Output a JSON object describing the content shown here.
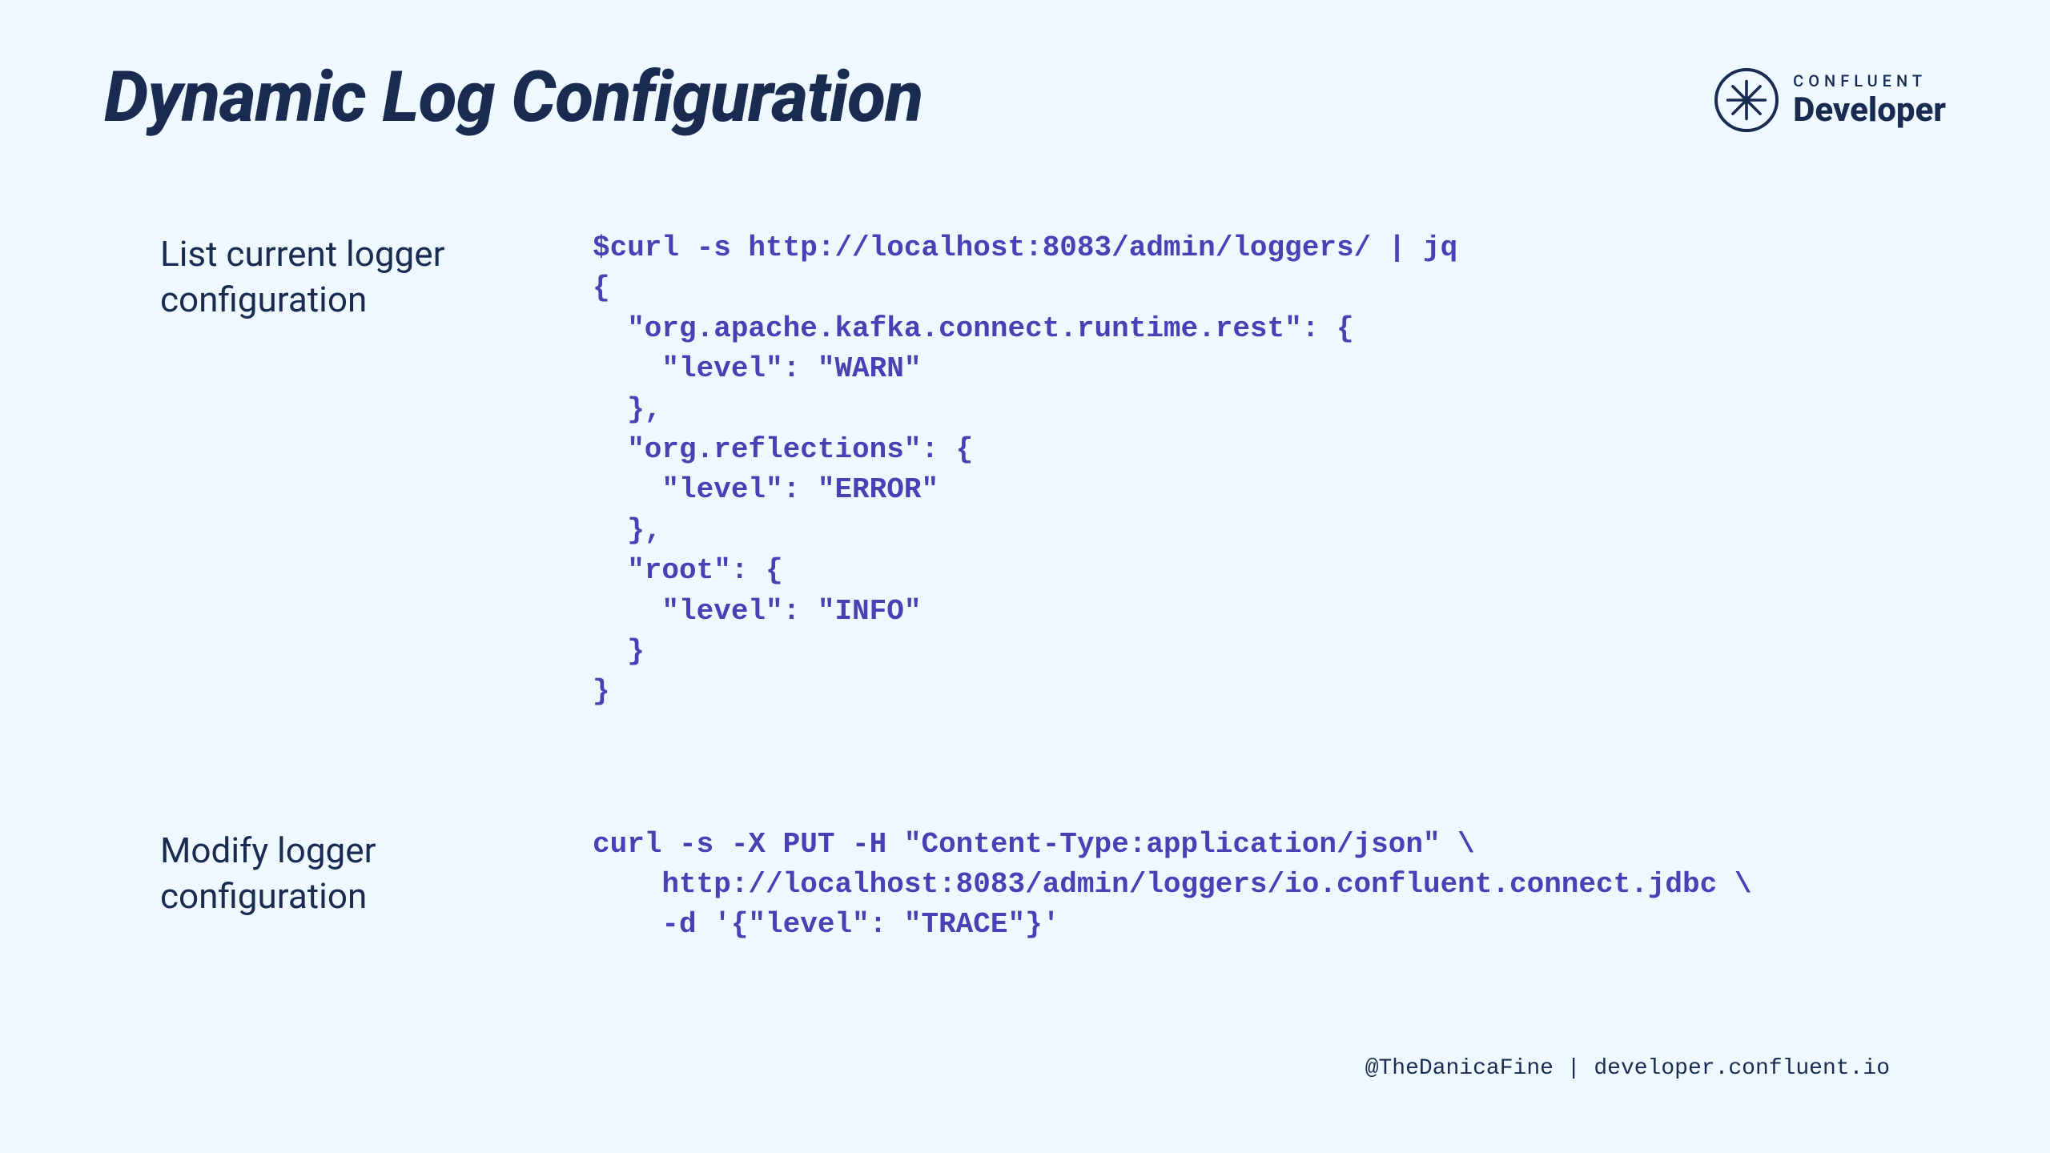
{
  "title": "Dynamic Log Configuration",
  "logo": {
    "small": "CONFLUENT",
    "big": "Developer"
  },
  "sections": {
    "list": {
      "label": "List current logger configuration",
      "code": "$curl -s http://localhost:8083/admin/loggers/ | jq\n{\n  \"org.apache.kafka.connect.runtime.rest\": {\n    \"level\": \"WARN\"\n  },\n  \"org.reflections\": {\n    \"level\": \"ERROR\"\n  },\n  \"root\": {\n    \"level\": \"INFO\"\n  }\n}"
    },
    "modify": {
      "label": "Modify logger configuration",
      "code": "curl -s -X PUT -H \"Content-Type:application/json\" \\\n    http://localhost:8083/admin/loggers/io.confluent.connect.jdbc \\\n    -d '{\"level\": \"TRACE\"}'"
    }
  },
  "footer": "@TheDanicaFine | developer.confluent.io"
}
